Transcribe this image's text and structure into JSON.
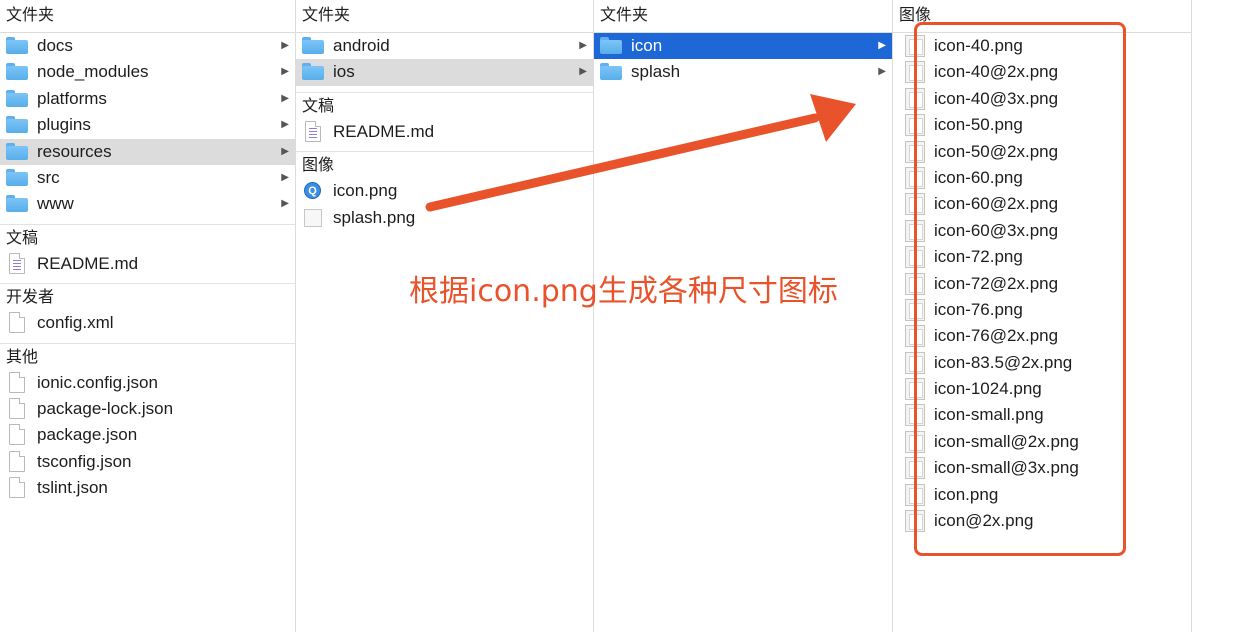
{
  "columns": [
    {
      "header": "文件夹",
      "folders": [
        {
          "name": "docs",
          "selected": false
        },
        {
          "name": "node_modules",
          "selected": false
        },
        {
          "name": "platforms",
          "selected": false
        },
        {
          "name": "plugins",
          "selected": false
        },
        {
          "name": "resources",
          "selected": "gray"
        },
        {
          "name": "src",
          "selected": false
        },
        {
          "name": "www",
          "selected": false
        }
      ],
      "sections": [
        {
          "label": "文稿",
          "items": [
            {
              "name": "README.md",
              "icon": "markdown-file-icon"
            }
          ]
        },
        {
          "label": "开发者",
          "items": [
            {
              "name": "config.xml",
              "icon": "file-icon"
            }
          ]
        },
        {
          "label": "其他",
          "items": [
            {
              "name": "ionic.config.json",
              "icon": "file-icon"
            },
            {
              "name": "package-lock.json",
              "icon": "file-icon"
            },
            {
              "name": "package.json",
              "icon": "file-icon"
            },
            {
              "name": "tsconfig.json",
              "icon": "file-icon"
            },
            {
              "name": "tslint.json",
              "icon": "file-icon"
            }
          ]
        }
      ]
    },
    {
      "header": "文件夹",
      "folders": [
        {
          "name": "android",
          "selected": false
        },
        {
          "name": "ios",
          "selected": "gray"
        }
      ],
      "sections": [
        {
          "label": "文稿",
          "items": [
            {
              "name": "README.md",
              "icon": "markdown-file-icon"
            }
          ]
        },
        {
          "label": "图像",
          "items": [
            {
              "name": "icon.png",
              "icon": "app-icon"
            },
            {
              "name": "splash.png",
              "icon": "image-thumbnail-icon"
            }
          ]
        }
      ]
    },
    {
      "header": "文件夹",
      "folders": [
        {
          "name": "icon",
          "selected": "blue"
        },
        {
          "name": "splash",
          "selected": false
        }
      ]
    },
    {
      "header": "图像",
      "files": [
        "icon-40.png",
        "icon-40@2x.png",
        "icon-40@3x.png",
        "icon-50.png",
        "icon-50@2x.png",
        "icon-60.png",
        "icon-60@2x.png",
        "icon-60@3x.png",
        "icon-72.png",
        "icon-72@2x.png",
        "icon-76.png",
        "icon-76@2x.png",
        "icon-83.5@2x.png",
        "icon-1024.png",
        "icon-small.png",
        "icon-small@2x.png",
        "icon-small@3x.png",
        "icon.png",
        "icon@2x.png"
      ]
    }
  ],
  "annotation": {
    "text": "根据icon.png生成各种尺寸图标",
    "color": "#e8532b"
  },
  "colors": {
    "selection_blue": "#1e67d6",
    "selection_gray": "#dcdcdc",
    "folder_blue": "#6ab8f2"
  }
}
